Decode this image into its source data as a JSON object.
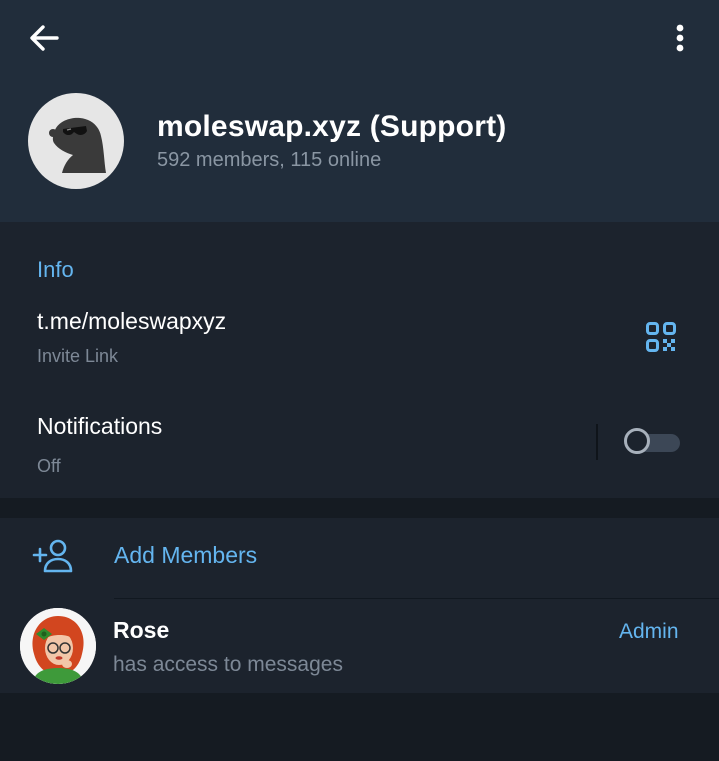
{
  "header": {
    "back_icon": "arrow-left-icon",
    "menu_icon": "more-vertical-icon",
    "title": "moleswap.xyz (Support)",
    "subtitle": "592 members, 115 online"
  },
  "info": {
    "section_title": "Info",
    "link": "t.me/moleswapxyz",
    "link_caption": "Invite Link",
    "qr_icon": "qr-code-icon",
    "notifications_label": "Notifications",
    "notifications_value": "Off",
    "notifications_enabled": false
  },
  "members": {
    "add_icon": "add-user-icon",
    "add_label": "Add Members",
    "list": [
      {
        "name": "Rose",
        "status": "has access to messages",
        "role": "Admin"
      }
    ]
  },
  "colors": {
    "header_bg": "#212d3b",
    "body_bg": "#1c232d",
    "accent": "#64b5ef",
    "muted_text": "#7d8896"
  }
}
